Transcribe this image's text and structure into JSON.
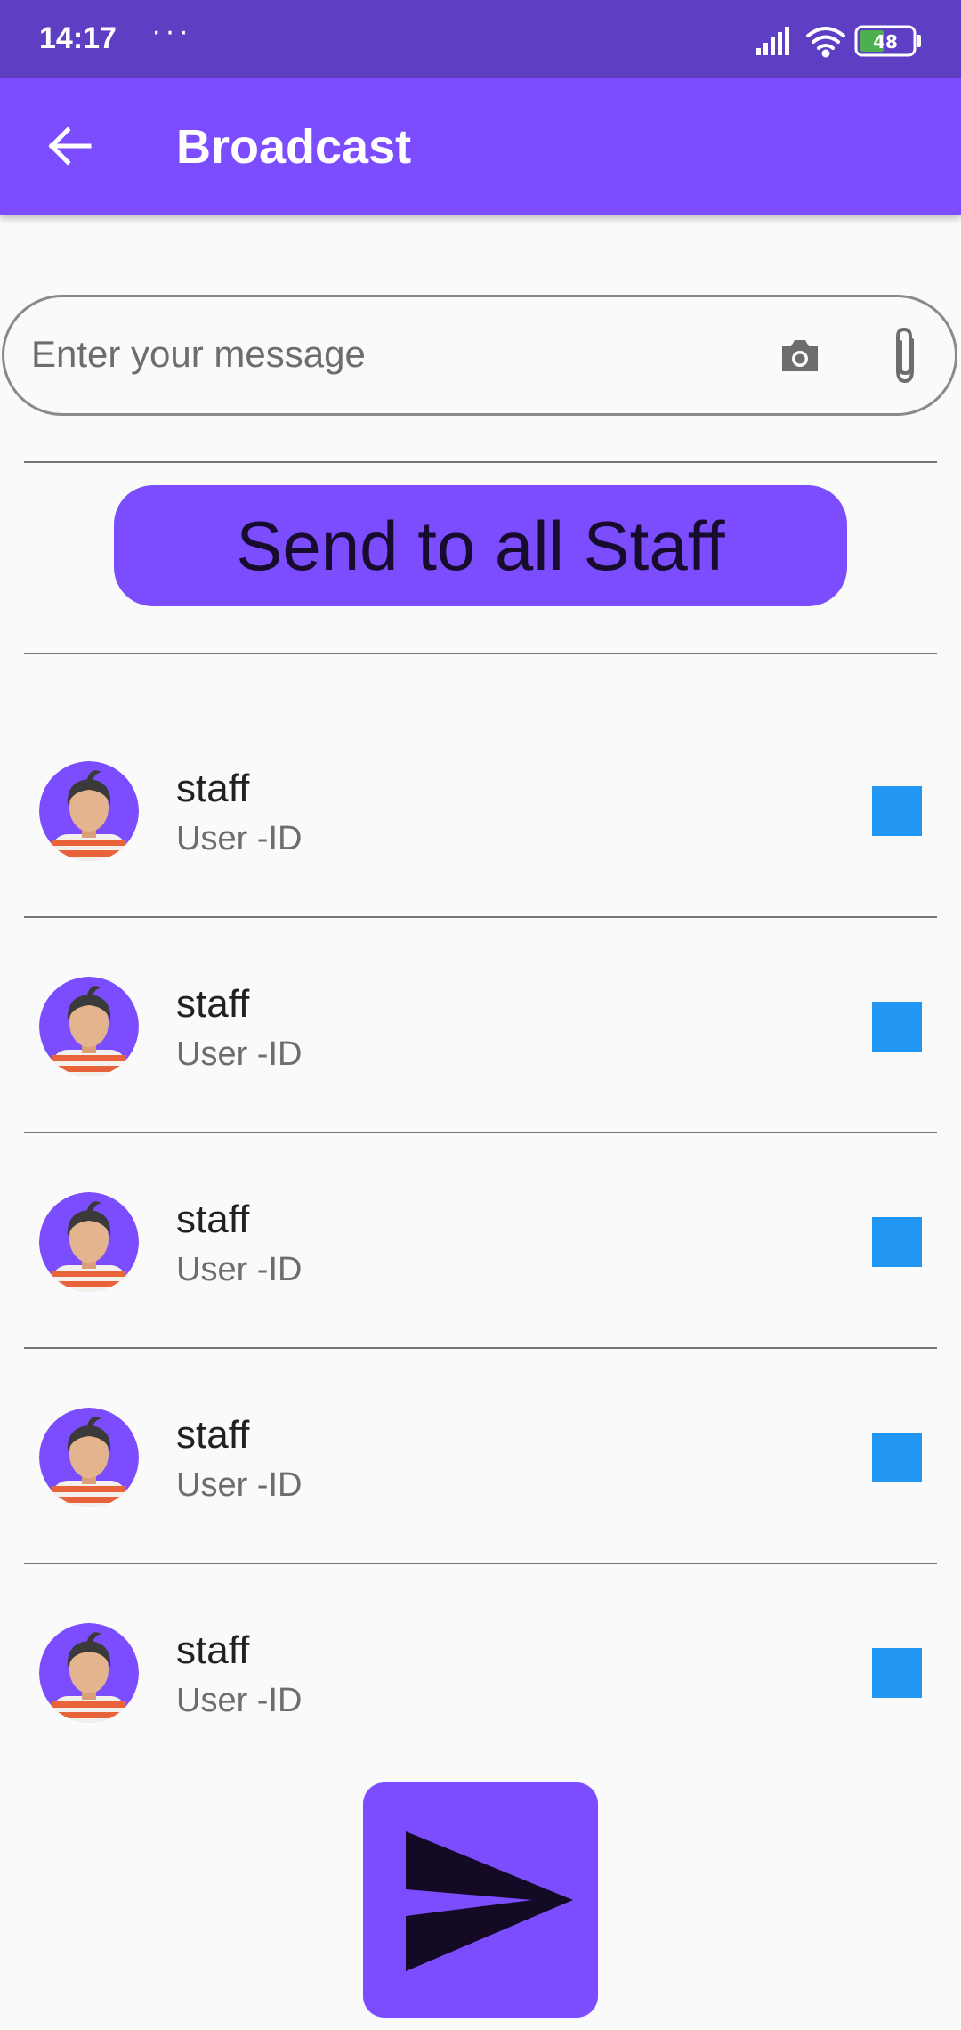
{
  "status_bar": {
    "time": "14:17",
    "dots": "···",
    "battery": "48"
  },
  "app_bar": {
    "title": "Broadcast",
    "back_icon": "arrow-left-icon"
  },
  "composer": {
    "placeholder": "Enter your message",
    "camera_icon": "camera-icon",
    "attach_icon": "paperclip-icon"
  },
  "send_all_button": {
    "label": "Send to all Staff"
  },
  "staff_list": [
    {
      "name": "staff",
      "id": "User -ID",
      "checked": true
    },
    {
      "name": "staff",
      "id": "User -ID",
      "checked": true
    },
    {
      "name": "staff",
      "id": "User -ID",
      "checked": true
    },
    {
      "name": "staff",
      "id": "User -ID",
      "checked": true
    },
    {
      "name": "staff",
      "id": "User -ID",
      "checked": true
    }
  ],
  "send_button": {
    "icon": "send-icon"
  },
  "colors": {
    "status_bar": "#5E3FC4",
    "primary": "#7C4DFF",
    "checkbox": "#2196F3",
    "background": "#FAFAFA"
  }
}
